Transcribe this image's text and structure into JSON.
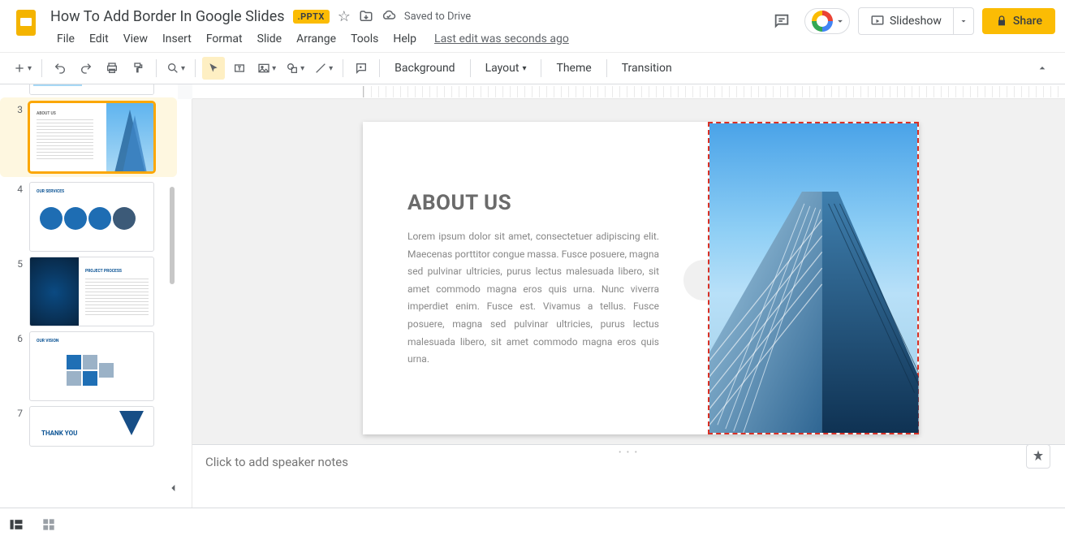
{
  "header": {
    "doc_title": "How To Add Border In Google Slides",
    "badge": ".PPTX",
    "saved_status": "Saved to Drive",
    "last_edit": "Last edit was seconds ago",
    "slideshow_label": "Slideshow",
    "share_label": "Share"
  },
  "menus": [
    "File",
    "Edit",
    "View",
    "Insert",
    "Format",
    "Slide",
    "Arrange",
    "Tools",
    "Help"
  ],
  "toolbar": {
    "background": "Background",
    "layout": "Layout",
    "theme": "Theme",
    "transition": "Transition"
  },
  "slide": {
    "heading": "ABOUT US",
    "body": "Lorem ipsum dolor sit amet, consectetuer adipiscing elit. Maecenas porttitor congue massa. Fusce posuere, magna sed pulvinar ultricies, purus lectus malesuada libero, sit amet commodo magna eros quis urna. Nunc viverra imperdiet enim. Fusce est. Vivamus a tellus. Fusce posuere, magna sed pulvinar ultricies, purus lectus malesuada libero, sit amet commodo magna eros quis urna."
  },
  "notes_placeholder": "Click to add speaker notes",
  "thumbs": [
    {
      "n": "3",
      "title": "ABOUT US"
    },
    {
      "n": "4",
      "title": "OUR SERVICES"
    },
    {
      "n": "5",
      "title": "PROJECT PROCESS"
    },
    {
      "n": "6",
      "title": "OUR VISION"
    },
    {
      "n": "7",
      "title": "THANK YOU"
    }
  ]
}
